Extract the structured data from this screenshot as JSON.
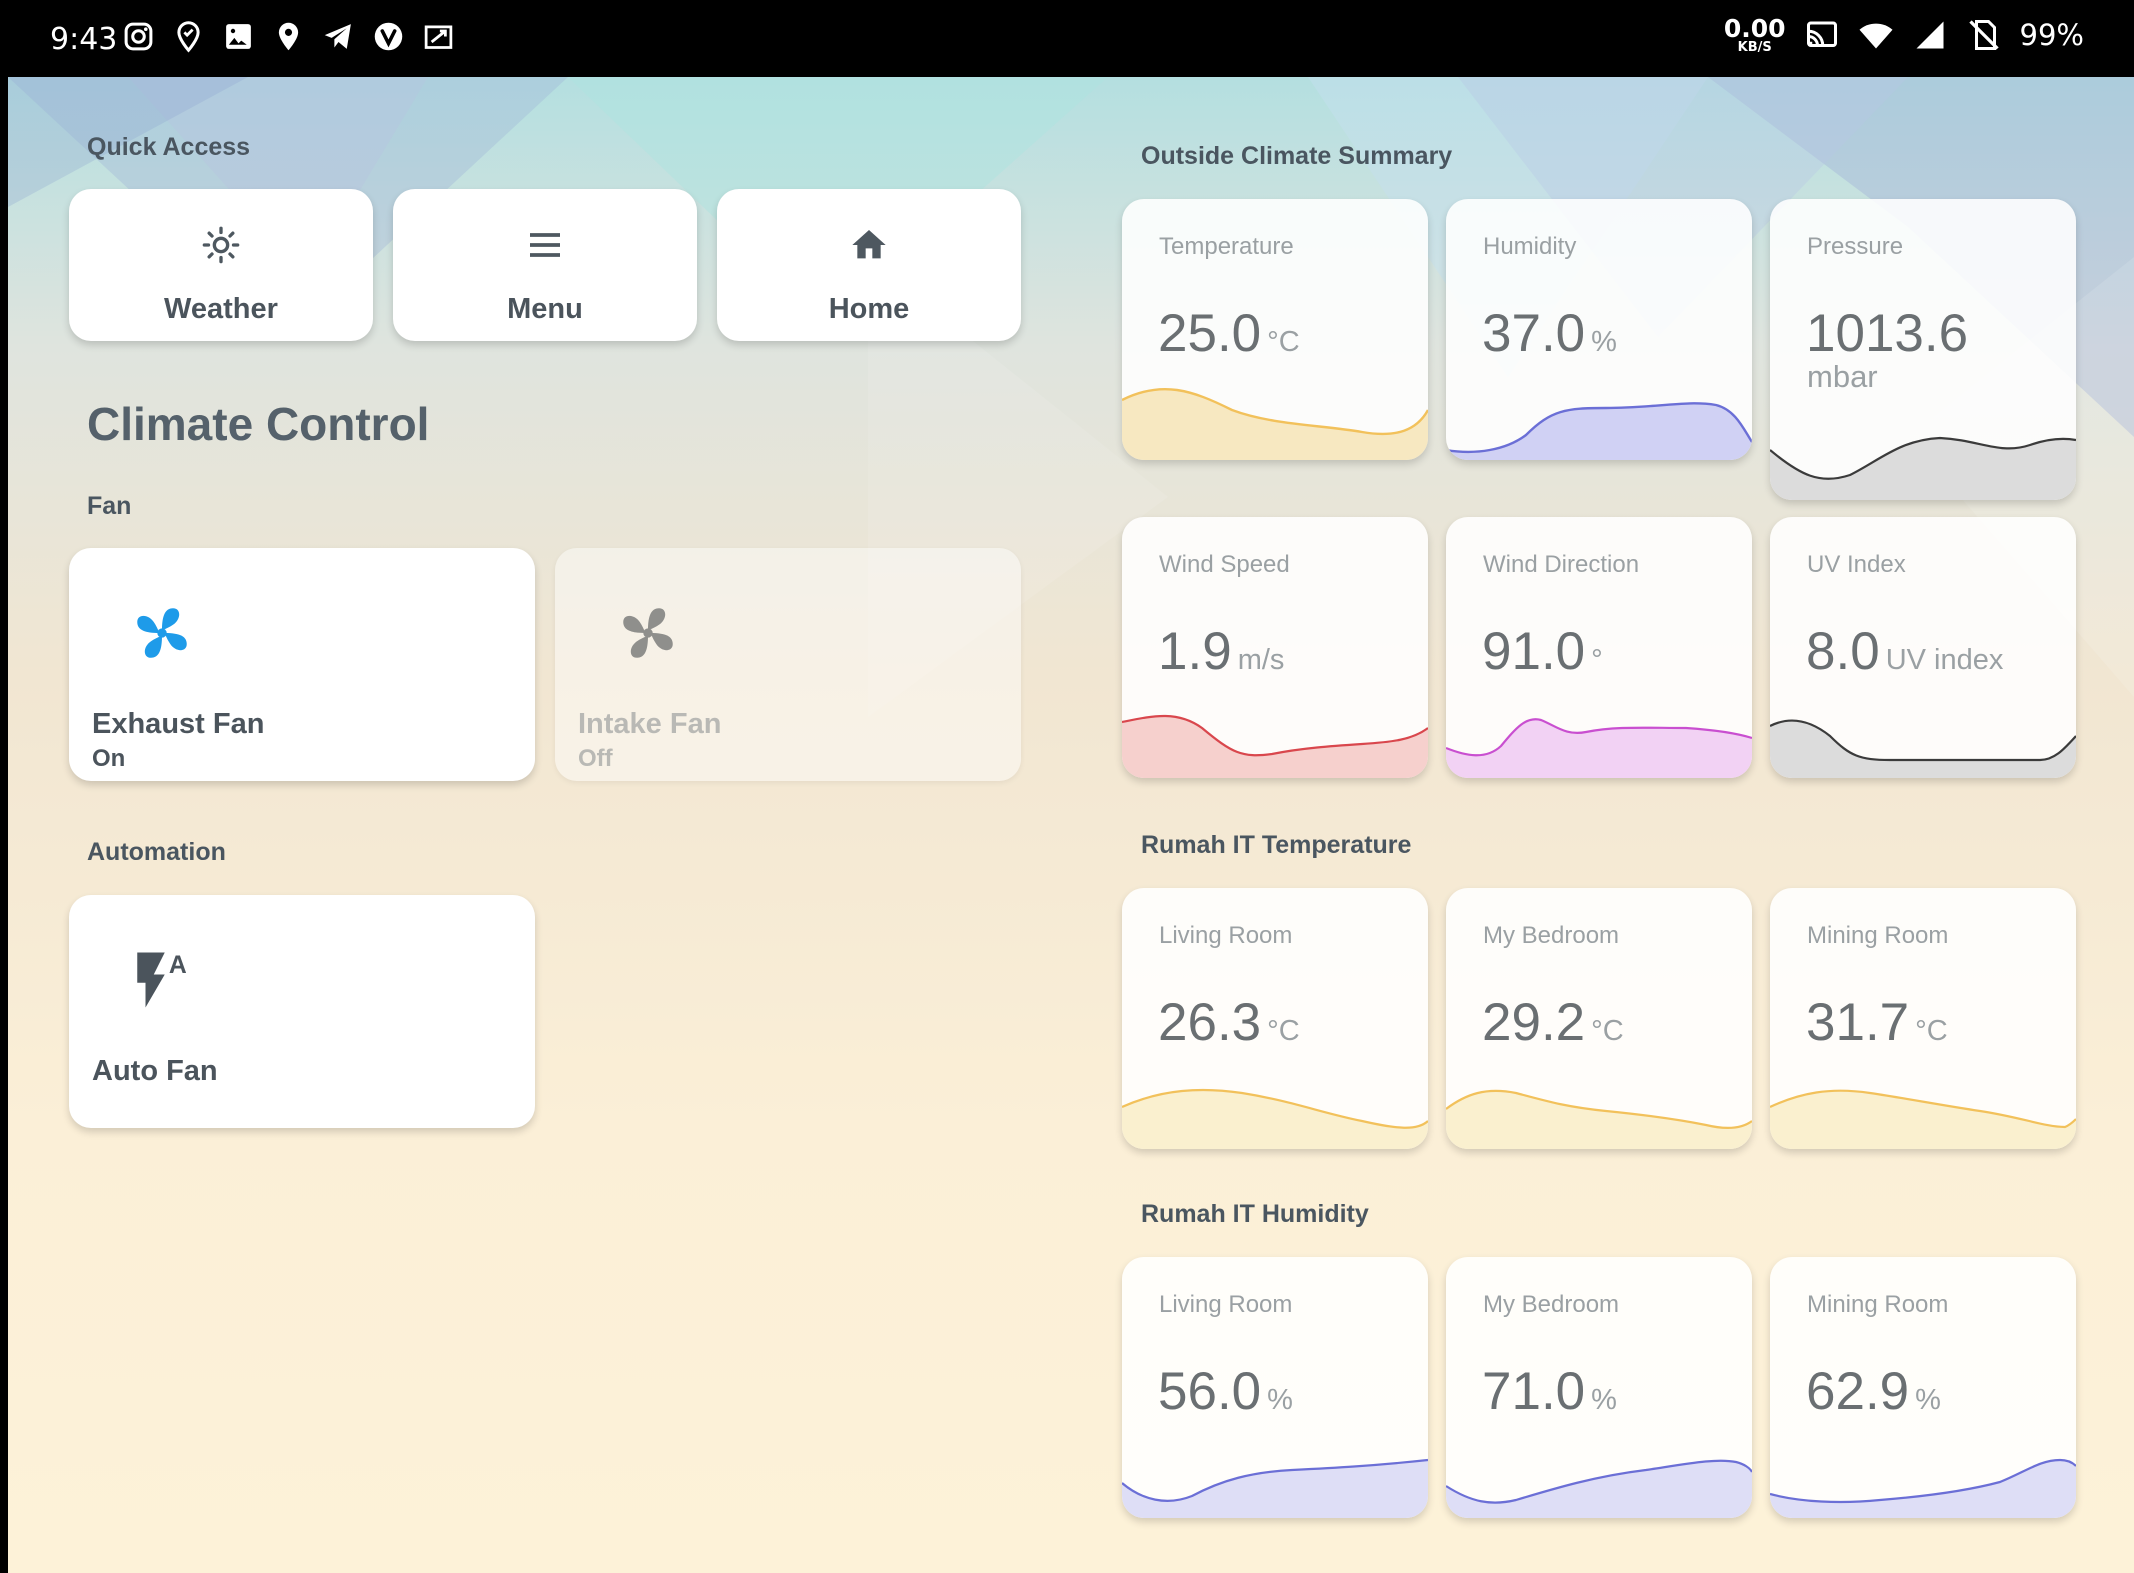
{
  "status_bar": {
    "time": "9:43",
    "net_speed_value": "0.00",
    "net_speed_unit": "KB/S",
    "battery": "99%",
    "left_icons": [
      "instagram-icon",
      "location-marker-icon",
      "image-icon",
      "map-pin-icon",
      "telegram-icon",
      "vivaldi-icon",
      "screenshot-icon"
    ],
    "right_icons": [
      "cast-icon",
      "wifi-icon",
      "signal-icon",
      "no-sim-icon"
    ]
  },
  "quick_access": {
    "label": "Quick Access",
    "buttons": [
      {
        "label": "Weather",
        "icon": "sun-icon"
      },
      {
        "label": "Menu",
        "icon": "menu-icon"
      },
      {
        "label": "Home",
        "icon": "home-icon"
      }
    ]
  },
  "climate_control": {
    "title": "Climate Control",
    "fan_label": "Fan",
    "fans": [
      {
        "name": "Exhaust Fan",
        "state": "On",
        "icon": "fan-icon",
        "color": "#1e9be9"
      },
      {
        "name": "Intake Fan",
        "state": "Off",
        "icon": "fan-icon",
        "color": "#8f8f8c"
      }
    ],
    "automation_label": "Automation",
    "automations": [
      {
        "name": "Auto Fan",
        "icon": "auto-flash-icon"
      }
    ]
  },
  "outside": {
    "label": "Outside Climate Summary",
    "sensors": [
      {
        "title": "Temperature",
        "value": "25.0",
        "unit": "°C",
        "color": "#f2c15b"
      },
      {
        "title": "Humidity",
        "value": "37.0",
        "unit": "%",
        "color": "#6b6fd6"
      },
      {
        "title": "Pressure",
        "value": "1013.6",
        "unit": "mbar",
        "color": "#3b3b3b"
      },
      {
        "title": "Wind Speed",
        "value": "1.9",
        "unit": "m/s",
        "color": "#d9474d"
      },
      {
        "title": "Wind Direction",
        "value": "91.0",
        "unit": "°",
        "color": "#c94fd0"
      },
      {
        "title": "UV Index",
        "value": "8.0",
        "unit": "UV index",
        "color": "#3b3b3b"
      }
    ]
  },
  "rumah_temp": {
    "label": "Rumah IT Temperature",
    "sensors": [
      {
        "title": "Living Room",
        "value": "26.3",
        "unit": "°C",
        "color": "#f2c15b"
      },
      {
        "title": "My Bedroom",
        "value": "29.2",
        "unit": "°C",
        "color": "#f2c15b"
      },
      {
        "title": "Mining Room",
        "value": "31.7",
        "unit": "°C",
        "color": "#f2c15b"
      }
    ]
  },
  "rumah_hum": {
    "label": "Rumah IT Humidity",
    "sensors": [
      {
        "title": "Living Room",
        "value": "56.0",
        "unit": "%",
        "color": "#6b6fd6"
      },
      {
        "title": "My Bedroom",
        "value": "71.0",
        "unit": "%",
        "color": "#6b6fd6"
      },
      {
        "title": "Mining Room",
        "value": "62.9",
        "unit": "%",
        "color": "#6b6fd6"
      }
    ]
  }
}
